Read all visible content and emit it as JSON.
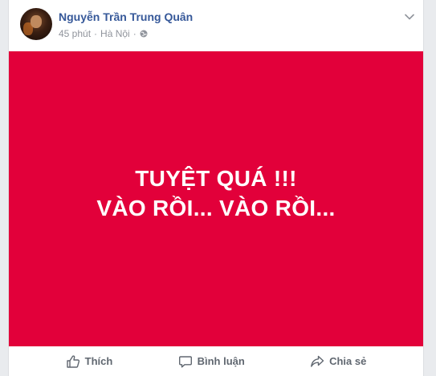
{
  "post": {
    "author": "Nguyễn Trần Trung Quân",
    "time": "45 phút",
    "separator": "·",
    "location": "Hà Nội",
    "privacy_icon": "globe-icon",
    "menu_icon": "chevron-down-icon",
    "banner": {
      "background": "#e2003a",
      "line1": "TUYỆT QUÁ !!!",
      "line2": "VÀO RỒI... VÀO RỒI..."
    }
  },
  "actions": {
    "like_label": "Thích",
    "comment_label": "Bình luận",
    "share_label": "Chia sẻ"
  },
  "colors": {
    "author": "#365899",
    "meta": "#90949c",
    "action": "#606770"
  }
}
